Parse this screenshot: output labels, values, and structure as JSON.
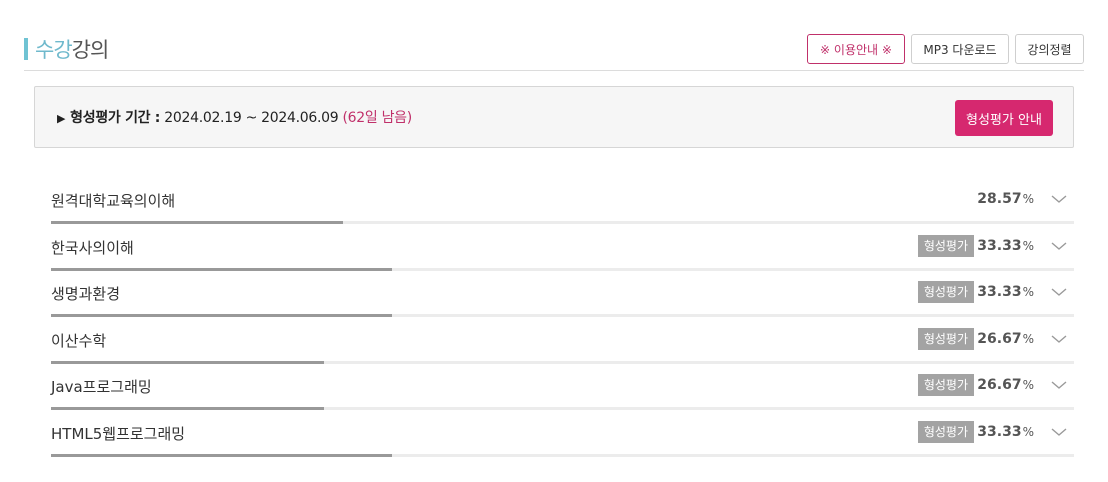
{
  "header": {
    "title_accent": "수강",
    "title_rest": "강의",
    "buttons": {
      "guide": "※ 이용안내 ※",
      "mp3": "MP3 다운로드",
      "sort": "강의정렬"
    }
  },
  "notice": {
    "label": "형성평가 기간 :",
    "period": "2024.02.19 ~ 2024.06.09",
    "remaining": "(62일 남음)",
    "button": "형성평가 안내"
  },
  "colors": {
    "accent": "#6fb9cc",
    "pink": "#d6286f",
    "progress": "#999999"
  },
  "courses": [
    {
      "name": "원격대학교육의이해",
      "badge": "",
      "percent": "28.57",
      "unit": "%",
      "progress": 0.2857
    },
    {
      "name": "한국사의이해",
      "badge": "형성평가",
      "percent": "33.33",
      "unit": "%",
      "progress": 0.3333
    },
    {
      "name": "생명과환경",
      "badge": "형성평가",
      "percent": "33.33",
      "unit": "%",
      "progress": 0.3333
    },
    {
      "name": "이산수학",
      "badge": "형성평가",
      "percent": "26.67",
      "unit": "%",
      "progress": 0.2667
    },
    {
      "name": "Java프로그래밍",
      "badge": "형성평가",
      "percent": "26.67",
      "unit": "%",
      "progress": 0.2667
    },
    {
      "name": "HTML5웹프로그래밍",
      "badge": "형성평가",
      "percent": "33.33",
      "unit": "%",
      "progress": 0.3333
    }
  ]
}
